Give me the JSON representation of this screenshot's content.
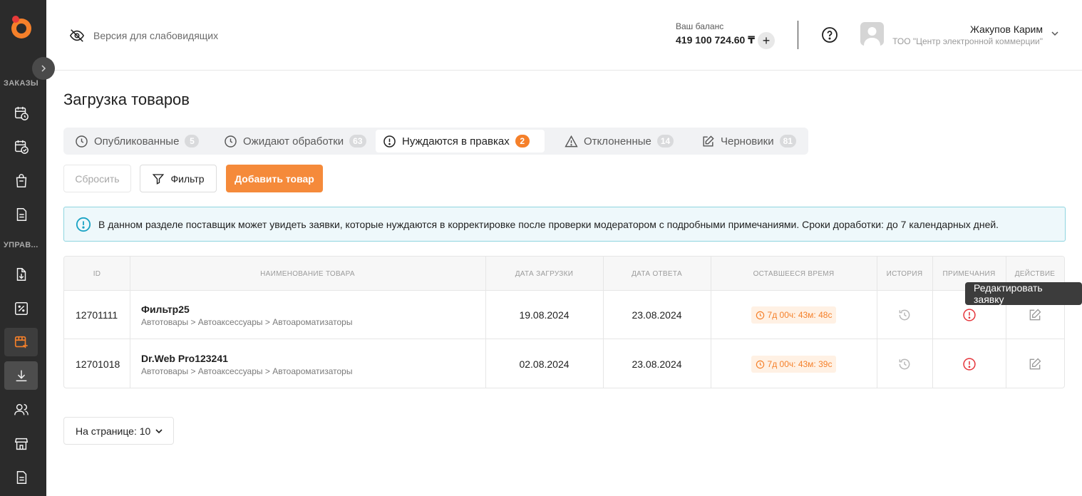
{
  "sidebar": {
    "section_orders": "ЗАКАЗЫ",
    "section_manage": "УПРАВ...",
    "items": [
      {
        "icon": "calendar-clock-icon"
      },
      {
        "icon": "calendar-check-icon"
      },
      {
        "icon": "shopping-bag-icon"
      },
      {
        "icon": "document-icon"
      },
      {
        "icon": "document-download-icon"
      },
      {
        "icon": "percent-icon"
      },
      {
        "icon": "add-product-icon"
      },
      {
        "icon": "download-icon"
      },
      {
        "icon": "users-icon"
      },
      {
        "icon": "store-icon"
      },
      {
        "icon": "document-list-icon"
      }
    ]
  },
  "header": {
    "accessibility_label": "Версия для слабовидящих",
    "balance_label": "Ваш баланс",
    "balance_value": "419 100 724.60 ₸",
    "balance_add": "+",
    "user_name": "Жакупов Карим",
    "user_org": "ТОО \"Центр электронной коммерции\""
  },
  "page": {
    "title": "Загрузка товаров"
  },
  "tabs": [
    {
      "label": "Опубликованные",
      "count": "5",
      "icon": "clock-icon"
    },
    {
      "label": "Ожидают обработки",
      "count": "63",
      "icon": "clock-icon"
    },
    {
      "label": "Нуждаются в правках",
      "count": "2",
      "icon": "alert-circle-icon",
      "active": true
    },
    {
      "label": "Отклоненные",
      "count": "14",
      "icon": "warning-triangle-icon"
    },
    {
      "label": "Черновики",
      "count": "81",
      "icon": "edit-icon"
    }
  ],
  "toolbar": {
    "reset_label": "Сбросить",
    "filter_label": "Фильтр",
    "add_label": "Добавить товар"
  },
  "info": {
    "text": "В данном разделе поставщик может увидеть заявки, которые нуждаются в корректировке после проверки модератором с подробными примечаниями. Сроки доработки: до 7 календарных дней."
  },
  "table": {
    "columns": [
      "ID",
      "НАИМЕНОВАНИЕ ТОВАРА",
      "ДАТА ЗАГРУЗКИ",
      "ДАТА ОТВЕТА",
      "ОСТАВШЕЕСЯ ВРЕМЯ",
      "ИСТОРИЯ",
      "ПРИМЕЧАНИЯ",
      "ДЕЙСТВИЕ"
    ],
    "rows": [
      {
        "id": "12701111",
        "name": "Фильтр25",
        "category": "Автотовары > Автоаксессуары > Автоароматизаторы",
        "upload_date": "19.08.2024",
        "answer_date": "23.08.2024",
        "remaining": "7д 00ч: 43м: 48с"
      },
      {
        "id": "12701018",
        "name": "Dr.Web Pro123241",
        "category": "Автотовары > Автоаксессуары > Автоароматизаторы",
        "upload_date": "02.08.2024",
        "answer_date": "23.08.2024",
        "remaining": "7д 00ч: 43м: 39с"
      }
    ]
  },
  "tooltip": "Редактировать заявку",
  "pager": {
    "label": "На странице: 10"
  },
  "colors": {
    "accent": "#f5802a",
    "sidebar": "#2b2b2b",
    "danger": "#e5343a",
    "info_border": "#8fd5e0"
  }
}
